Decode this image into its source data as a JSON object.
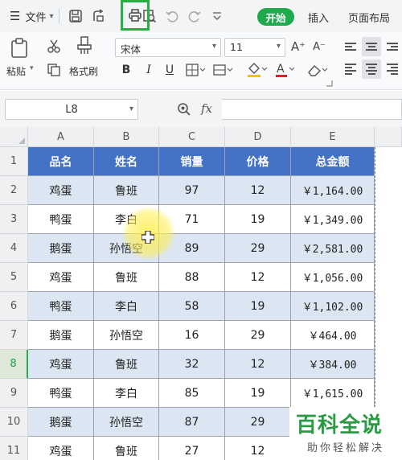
{
  "menubar": {
    "file_label": "文件",
    "tabs": {
      "start": "开始",
      "insert": "插入",
      "layout": "页面布局"
    }
  },
  "ribbon": {
    "paste_label": "粘贴",
    "format_painter_label": "格式刷",
    "font_name": "宋体",
    "font_size": "11",
    "bold": "B",
    "italic": "I",
    "underline": "U"
  },
  "formula_bar": {
    "cell_ref": "L8",
    "fx": "fx"
  },
  "sheet": {
    "columns": [
      "A",
      "B",
      "C",
      "D",
      "E"
    ],
    "header": [
      "品名",
      "姓名",
      "销量",
      "价格",
      "总金额"
    ],
    "rows": [
      [
        "鸡蛋",
        "鲁班",
        "97",
        "12",
        "￥1,164.00"
      ],
      [
        "鸭蛋",
        "李白",
        "71",
        "19",
        "￥1,349.00"
      ],
      [
        "鹅蛋",
        "孙悟空",
        "89",
        "29",
        "￥2,581.00"
      ],
      [
        "鸡蛋",
        "鲁班",
        "88",
        "12",
        "￥1,056.00"
      ],
      [
        "鸭蛋",
        "李白",
        "58",
        "19",
        "￥1,102.00"
      ],
      [
        "鹅蛋",
        "孙悟空",
        "16",
        "29",
        "￥464.00"
      ],
      [
        "鸡蛋",
        "鲁班",
        "32",
        "12",
        "￥384.00"
      ],
      [
        "鸭蛋",
        "李白",
        "85",
        "19",
        "￥1,615.00"
      ],
      [
        "鹅蛋",
        "孙悟空",
        "87",
        "29",
        ""
      ],
      [
        "鸡蛋",
        "鲁班",
        "27",
        "12",
        ""
      ]
    ],
    "row_numbers": [
      "1",
      "2",
      "3",
      "4",
      "5",
      "6",
      "7",
      "8",
      "9",
      "10",
      "11"
    ],
    "active_row": "8"
  },
  "watermark": {
    "title": "百科全说",
    "subtitle": "助你轻松解决"
  },
  "colors": {
    "header_fill": "#4472c4",
    "band_fill": "#dce6f2",
    "accent_green": "#1faa4e"
  }
}
